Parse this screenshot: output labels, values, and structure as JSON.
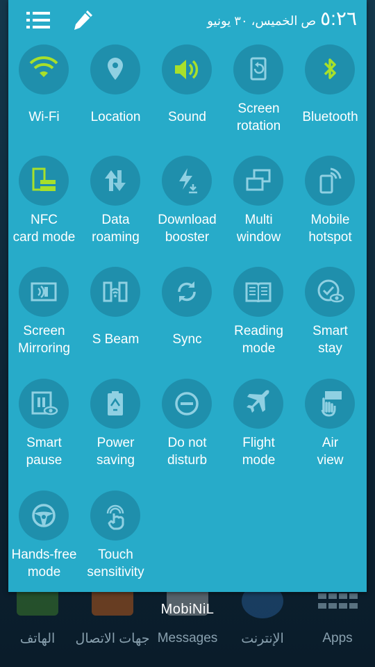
{
  "status": {
    "time": "٥:٢٦",
    "meridiem_date": "ص الخميس، ٣٠ يونيو"
  },
  "colors": {
    "panel": "#27abc9",
    "tile": "#1f8fac",
    "active_icon": "#a8e02a",
    "inactive_icon": "#8fd0e2"
  },
  "tiles": [
    {
      "label": "Wi-Fi",
      "icon": "wifi-icon",
      "active": true
    },
    {
      "label": "Location",
      "icon": "location-pin-icon",
      "active": false
    },
    {
      "label": "Sound",
      "icon": "speaker-icon",
      "active": true
    },
    {
      "label": "Screen\nrotation",
      "icon": "rotation-icon",
      "active": false
    },
    {
      "label": "Bluetooth",
      "icon": "bluetooth-icon",
      "active": true
    },
    {
      "label": "NFC\ncard mode",
      "icon": "nfc-icon",
      "active": true
    },
    {
      "label": "Data\nroaming",
      "icon": "data-roaming-icon",
      "active": false
    },
    {
      "label": "Download\nbooster",
      "icon": "download-booster-icon",
      "active": false
    },
    {
      "label": "Multi\nwindow",
      "icon": "multi-window-icon",
      "active": false
    },
    {
      "label": "Mobile\nhotspot",
      "icon": "hotspot-icon",
      "active": false
    },
    {
      "label": "Screen\nMirroring",
      "icon": "screen-mirroring-icon",
      "active": false
    },
    {
      "label": "S Beam",
      "icon": "s-beam-icon",
      "active": false
    },
    {
      "label": "Sync",
      "icon": "sync-icon",
      "active": false
    },
    {
      "label": "Reading\nmode",
      "icon": "book-icon",
      "active": false
    },
    {
      "label": "Smart\nstay",
      "icon": "smart-stay-icon",
      "active": false
    },
    {
      "label": "Smart\npause",
      "icon": "smart-pause-icon",
      "active": false
    },
    {
      "label": "Power\nsaving",
      "icon": "battery-recycle-icon",
      "active": false
    },
    {
      "label": "Do not\ndisturb",
      "icon": "do-not-disturb-icon",
      "active": false
    },
    {
      "label": "Flight\nmode",
      "icon": "airplane-icon",
      "active": false
    },
    {
      "label": "Air\nview",
      "icon": "air-view-icon",
      "active": false
    },
    {
      "label": "Hands-free\nmode",
      "icon": "steering-wheel-icon",
      "active": false
    },
    {
      "label": "Touch\nsensitivity",
      "icon": "touch-icon",
      "active": false
    }
  ],
  "dock": [
    {
      "label": "الهاتف",
      "icon": "phone-icon"
    },
    {
      "label": "جهات الاتصال",
      "icon": "contacts-icon"
    },
    {
      "label": "Messages",
      "icon": "messages-icon"
    },
    {
      "label": "الإنترنت",
      "icon": "globe-icon"
    },
    {
      "label": "Apps",
      "icon": "apps-grid-icon"
    }
  ],
  "carrier": "MobiNiL"
}
